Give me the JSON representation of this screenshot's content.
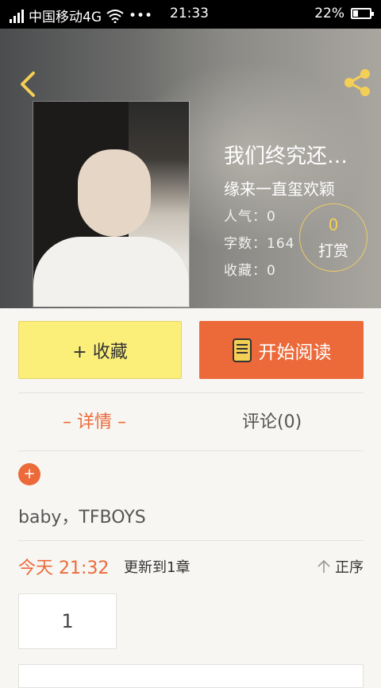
{
  "status_bar": {
    "carrier": "中国移动4G",
    "dots": "•••",
    "time": "21:33",
    "battery": "22%"
  },
  "book": {
    "title": "我们终究还…",
    "author": "缘来一直玺欢颖",
    "popularity_label": "人气：",
    "popularity": "0",
    "words_label": "字数：",
    "words": "164",
    "favorites_label": "收藏：",
    "favorites": "0"
  },
  "tip": {
    "count": "0",
    "label": "打赏"
  },
  "actions": {
    "collect": "+ 收藏",
    "read": "开始阅读"
  },
  "tabs": {
    "detail": "– 详情 –",
    "comment": "评论(0)"
  },
  "tags_text": "baby，TFBOYS",
  "update": {
    "time": "今天 21:32",
    "text": "更新到1章",
    "order": "正序"
  },
  "chapter_number": "1",
  "colors": {
    "accent": "#ec6a3a",
    "collect_bg": "#fbef7a",
    "icon_yellow": "#f4cf55"
  }
}
